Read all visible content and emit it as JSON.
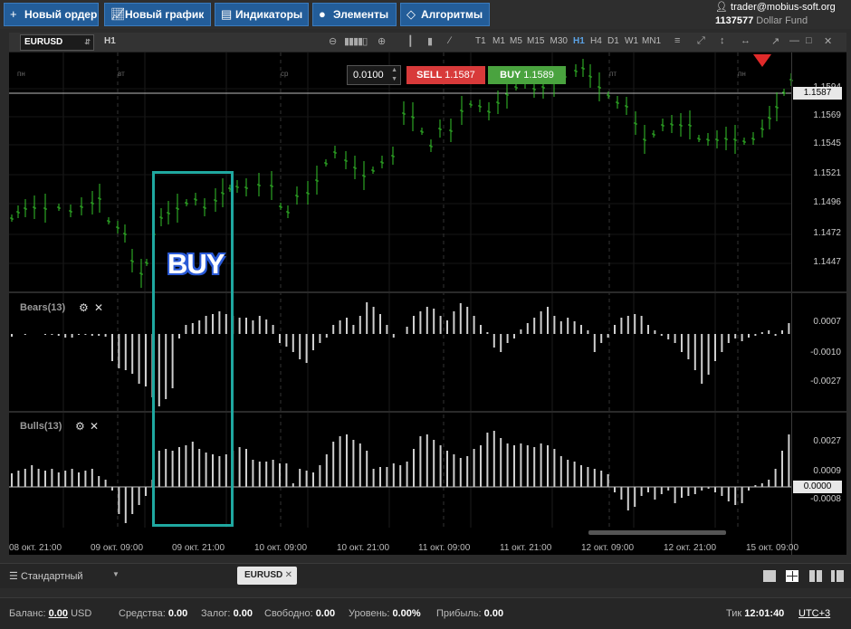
{
  "toolbar": {
    "new_order": "Новый ордер",
    "new_chart": "Новый график",
    "indicators": "Индикаторы",
    "elements": "Элементы",
    "algorithms": "Алгоритмы"
  },
  "account": {
    "email": "trader@mobius-soft.org",
    "number": "1137577",
    "fund": "Dollar Fund"
  },
  "chart": {
    "symbol": "EURUSD",
    "period_label": "H1",
    "timeframes": [
      "T1",
      "M1",
      "M5",
      "M15",
      "M30",
      "H1",
      "H4",
      "D1",
      "W1",
      "MN1"
    ],
    "active_timeframe": "H1",
    "lot": "0.0100",
    "sell_label": "SELL",
    "sell_price": "1.1587",
    "buy_label": "BUY",
    "buy_price": "1.1589",
    "annotation": "BUY",
    "days": [
      "пн",
      "вт",
      "ср",
      "чт",
      "пт",
      "пн"
    ],
    "price_ticks": [
      "1.1594",
      "1.1569",
      "1.1545",
      "1.1521",
      "1.1496",
      "1.1472",
      "1.1447"
    ],
    "current_price": "1.1587",
    "bears_label": "Bears(13)",
    "bears_ticks": [
      "0.0007",
      "-0.0010",
      "-0.0027"
    ],
    "bulls_label": "Bulls(13)",
    "bulls_ticks": [
      "0.0027",
      "0.0009",
      "-0.0008"
    ],
    "bulls_zero": "0.0000",
    "time_labels": [
      "08 окт. 21:00",
      "09 окт. 09:00",
      "09 окт. 21:00",
      "10 окт. 09:00",
      "10 окт. 21:00",
      "11 окт. 09:00",
      "11 окт. 21:00",
      "12 окт. 09:00",
      "12 окт. 21:00",
      "15 окт. 09:00"
    ],
    "colors": {
      "bull": "#35c42a",
      "bear": "#35c42a",
      "accent": "#1fa8a0"
    }
  },
  "bottom": {
    "template": "Стандартный",
    "tab": "EURUSD"
  },
  "status": {
    "balance_label": "Баланс:",
    "balance_value": "0.00",
    "balance_ccy": "USD",
    "funds_label": "Средства:",
    "funds_value": "0.00",
    "margin_label": "Залог:",
    "margin_value": "0.00",
    "free_label": "Свободно:",
    "free_value": "0.00",
    "level_label": "Уровень:",
    "level_value": "0.00%",
    "profit_label": "Прибыль:",
    "profit_value": "0.00",
    "tick_label": "Тик",
    "tick_value": "12:01:40",
    "tz": "UTC+3"
  }
}
